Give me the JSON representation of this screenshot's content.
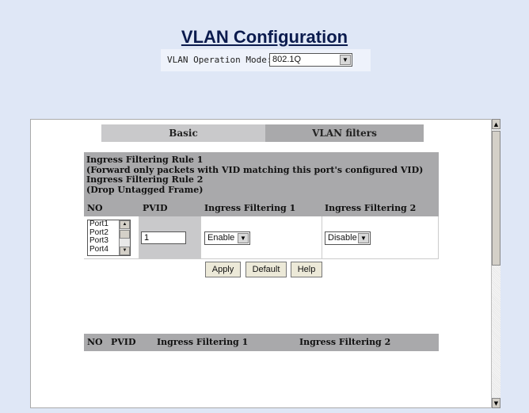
{
  "page": {
    "title": "VLAN Configuration"
  },
  "operation_mode": {
    "label": "VLAN Operation Mode:",
    "value": "802.1Q"
  },
  "tabs": [
    {
      "label": "Basic",
      "active": false
    },
    {
      "label": "VLAN filters",
      "active": true
    }
  ],
  "rules": [
    "Ingress Filtering Rule 1",
    "(Forward only packets with VID matching this port's configured VID)",
    "Ingress Filtering Rule 2",
    "(Drop Untagged Frame)"
  ],
  "table": {
    "headers": [
      "NO",
      "PVID",
      "Ingress Filtering 1",
      "Ingress Filtering 2"
    ],
    "ports": [
      "Port1",
      "Port2",
      "Port3",
      "Port4"
    ],
    "pvid_value": "1",
    "ingress1_value": "Enable",
    "ingress2_value": "Disable"
  },
  "buttons": {
    "apply": "Apply",
    "default": "Default",
    "help": "Help"
  },
  "summary_table": {
    "headers": [
      "NO",
      "PVID",
      "Ingress Filtering 1",
      "Ingress Filtering 2"
    ]
  },
  "colors": {
    "background": "#dfe7f6",
    "header_gray": "#a9a9ab",
    "title": "#0b1b4e"
  }
}
